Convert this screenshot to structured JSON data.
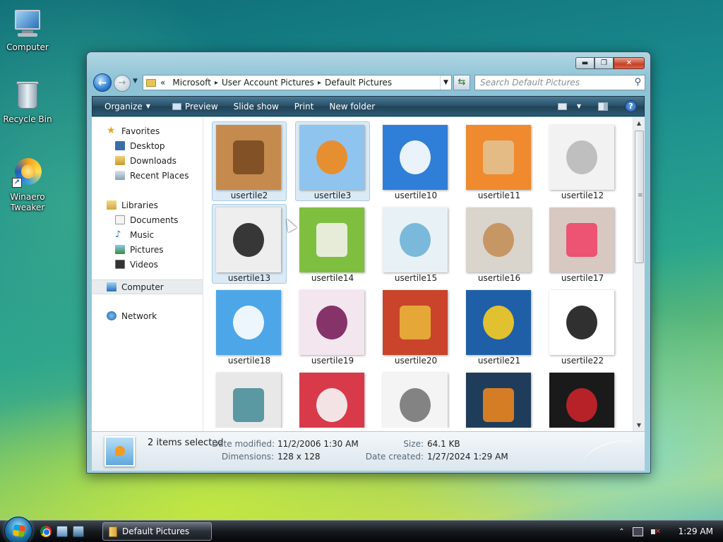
{
  "desktop": {
    "icons": [
      {
        "label": "Computer",
        "icon": "computer-icon"
      },
      {
        "label": "Recycle Bin",
        "icon": "recycle-bin-icon"
      },
      {
        "label": "Winaero\nTweaker",
        "line1": "Winaero",
        "line2": "Tweaker",
        "icon": "winaero-tweaker-icon"
      }
    ]
  },
  "window": {
    "caption_buttons": {
      "minimize": "▬",
      "maximize": "❐",
      "close": "✕"
    },
    "breadcrumb": {
      "overflow": "«",
      "items": [
        "Microsoft",
        "User Account Pictures",
        "Default Pictures"
      ],
      "separator": "▸"
    },
    "search_placeholder": "Search Default Pictures",
    "toolbar": {
      "organize": "Organize",
      "preview": "Preview",
      "slideshow": "Slide show",
      "print": "Print",
      "new_folder": "New folder"
    },
    "nav": {
      "favorites": "Favorites",
      "favorites_items": [
        "Desktop",
        "Downloads",
        "Recent Places"
      ],
      "libraries": "Libraries",
      "libraries_items": [
        "Documents",
        "Music",
        "Pictures",
        "Videos"
      ],
      "computer": "Computer",
      "network": "Network"
    },
    "files": [
      {
        "name": "usertile2",
        "selected": true,
        "colors": [
          "#c58a4e",
          "#7a4a22"
        ]
      },
      {
        "name": "usertile3",
        "selected": true,
        "colors": [
          "#8fc4ef",
          "#f08a1c"
        ]
      },
      {
        "name": "usertile10",
        "selected": false,
        "colors": [
          "#2f7ed8",
          "#ffffff"
        ]
      },
      {
        "name": "usertile11",
        "selected": false,
        "colors": [
          "#f08a2e",
          "#e2c08f"
        ]
      },
      {
        "name": "usertile12",
        "selected": false,
        "colors": [
          "#f2f2f2",
          "#b9b9b9"
        ]
      },
      {
        "name": "usertile13",
        "selected": true,
        "colors": [
          "#eeeeee",
          "#222222"
        ]
      },
      {
        "name": "usertile14",
        "selected": false,
        "colors": [
          "#7fbf3f",
          "#f3f1ea"
        ]
      },
      {
        "name": "usertile15",
        "selected": false,
        "colors": [
          "#e8f1f6",
          "#6fb3d8"
        ]
      },
      {
        "name": "usertile16",
        "selected": false,
        "colors": [
          "#d9d4cc",
          "#c48f5a"
        ]
      },
      {
        "name": "usertile17",
        "selected": false,
        "colors": [
          "#d8c8c2",
          "#f0466a"
        ]
      },
      {
        "name": "usertile18",
        "selected": false,
        "colors": [
          "#4da6e8",
          "#ffffff"
        ]
      },
      {
        "name": "usertile19",
        "selected": false,
        "colors": [
          "#f4e6ee",
          "#7a1f5a"
        ]
      },
      {
        "name": "usertile20",
        "selected": false,
        "colors": [
          "#c9442a",
          "#e8b33a"
        ]
      },
      {
        "name": "usertile21",
        "selected": false,
        "colors": [
          "#1f5fa8",
          "#f6cc22"
        ]
      },
      {
        "name": "usertile22",
        "selected": false,
        "colors": [
          "#ffffff",
          "#1a1a1a"
        ]
      },
      {
        "name": "",
        "selected": false,
        "colors": [
          "#e8e8e8",
          "#4a8f9a"
        ]
      },
      {
        "name": "",
        "selected": false,
        "colors": [
          "#d83a4a",
          "#f6f6f6"
        ]
      },
      {
        "name": "",
        "selected": false,
        "colors": [
          "#f4f4f4",
          "#777777"
        ]
      },
      {
        "name": "",
        "selected": false,
        "colors": [
          "#1f3d5a",
          "#e8841f"
        ]
      },
      {
        "name": "",
        "selected": false,
        "colors": [
          "#1a1a1a",
          "#c8242a"
        ]
      }
    ],
    "details": {
      "summary": "2 items selected",
      "date_modified_label": "Date modified:",
      "date_modified": "11/2/2006 1:30 AM",
      "dimensions_label": "Dimensions:",
      "dimensions": "128 x 128",
      "size_label": "Size:",
      "size": "64.1 KB",
      "date_created_label": "Date created:",
      "date_created": "1/27/2024 1:29 AM"
    }
  },
  "taskbar": {
    "task_label": "Default Pictures",
    "clock": "1:29 AM",
    "tray_overflow": "⌃"
  }
}
